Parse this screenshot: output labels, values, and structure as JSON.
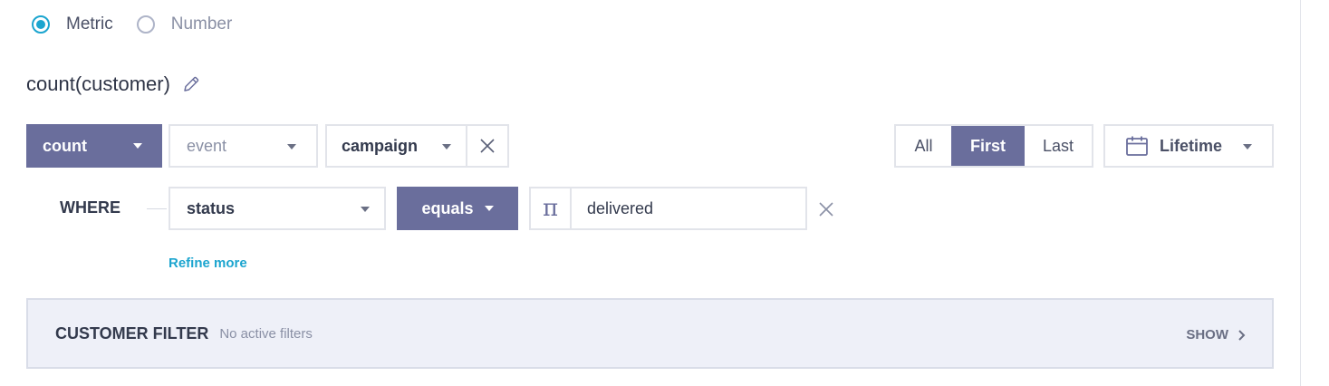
{
  "mode_selector": {
    "options": [
      {
        "label": "Metric",
        "selected": true
      },
      {
        "label": "Number",
        "selected": false
      }
    ]
  },
  "metric": {
    "title": "count(customer)"
  },
  "aggregation": {
    "function": "count",
    "source_placeholder": "event",
    "event_type": "campaign"
  },
  "occurrence": {
    "options": [
      "All",
      "First",
      "Last"
    ],
    "selected": "First"
  },
  "date_range": {
    "label": "Lifetime"
  },
  "condition": {
    "where_label": "WHERE",
    "property": "status",
    "operator": "equals",
    "type_glyph": "π",
    "value": "delivered"
  },
  "refine_label": "Refine more",
  "customer_filter": {
    "title": "CUSTOMER FILTER",
    "status": "No active filters",
    "show_label": "SHOW"
  },
  "colors": {
    "accent": "#1ca5cf",
    "primary": "#6a6e9c",
    "border": "#e2e4ea",
    "filter_bg": "#eef0f8"
  }
}
